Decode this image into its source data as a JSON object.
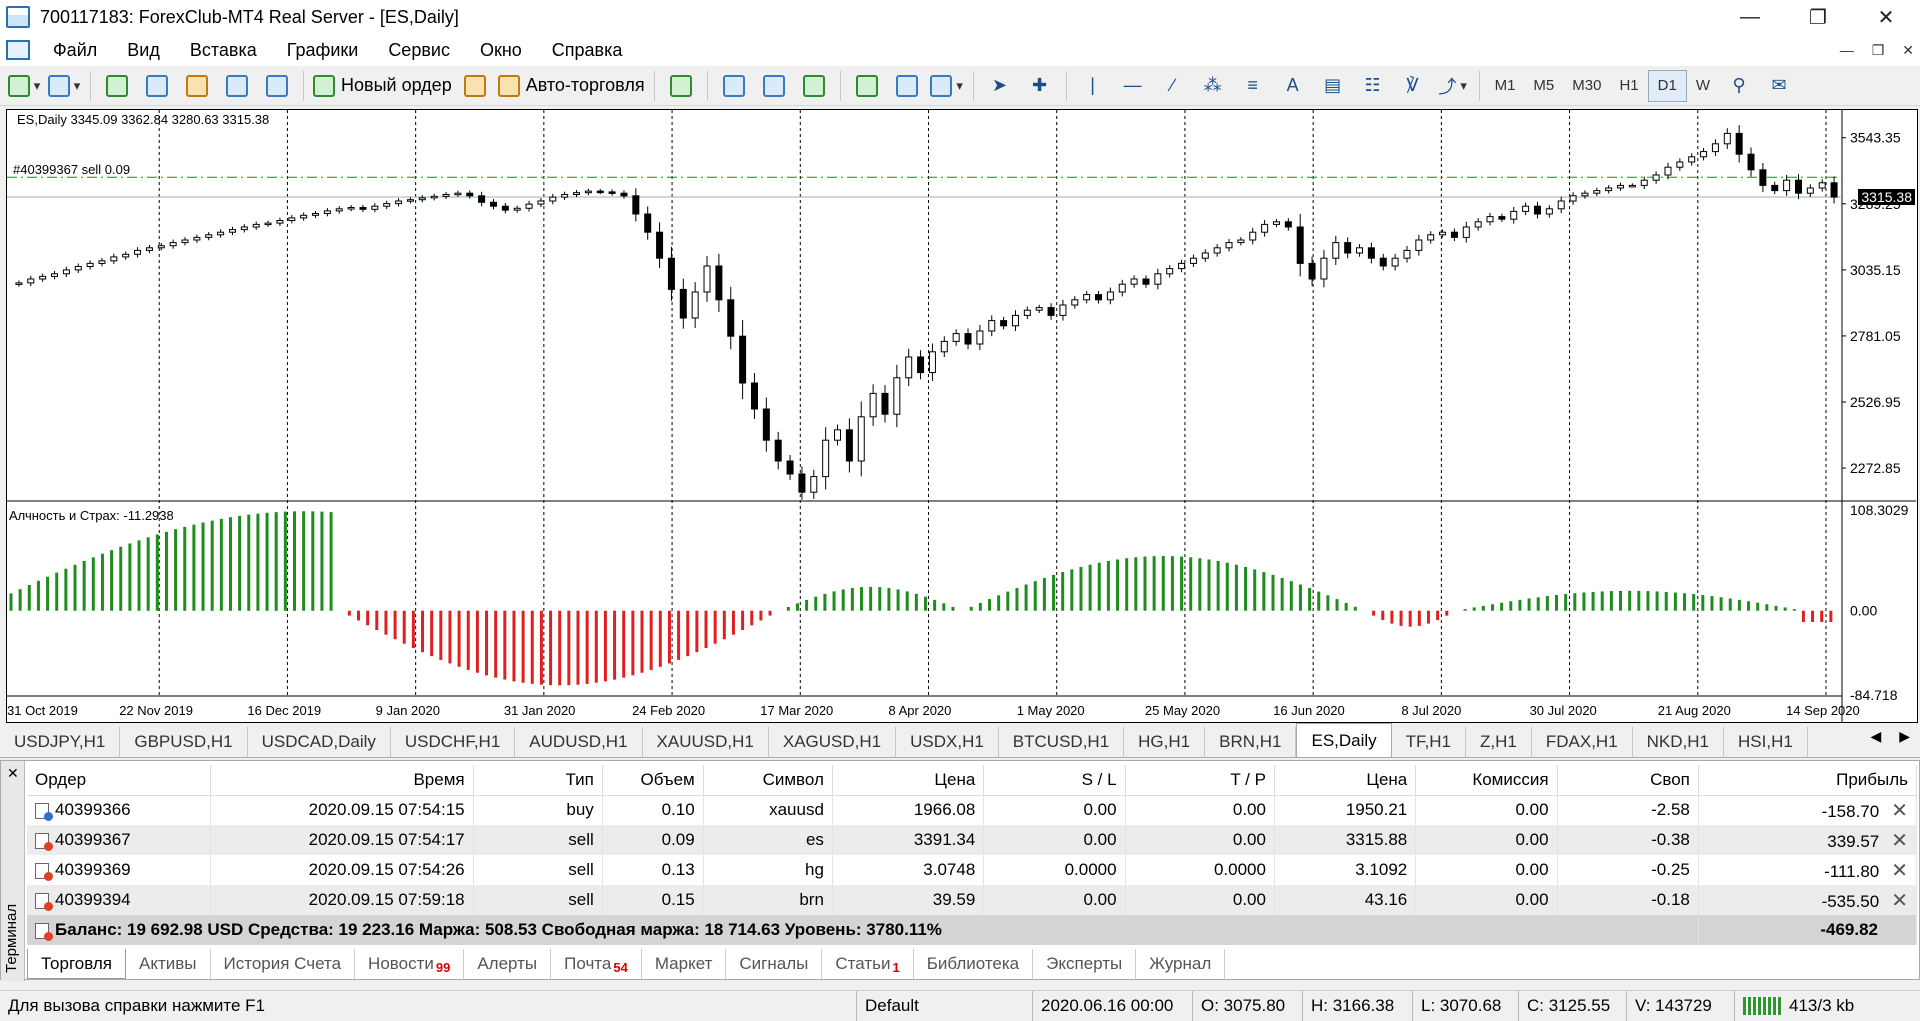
{
  "window": {
    "title": "700117183: ForexClub-MT4 Real Server - [ES,Daily]"
  },
  "menu": [
    "Файл",
    "Вид",
    "Вставка",
    "Графики",
    "Сервис",
    "Окно",
    "Справка"
  ],
  "toolbar": {
    "new_order": "Новый ордер",
    "autotrading": "Авто-торговля",
    "timeframes": [
      "M1",
      "M5",
      "M30",
      "H1",
      "D1",
      "W"
    ],
    "active_timeframe": "D1",
    "text_tool": "A"
  },
  "chart": {
    "header": "ES,Daily  3345.09 3362.84 3280.63 3315.38",
    "order_line_label": "#40399367 sell 0.09",
    "current_price": "3315.38",
    "price_ticks": [
      "3543.35",
      "3289.25",
      "3035.15",
      "2781.05",
      "2526.95",
      "2272.85"
    ],
    "indicator_label": "Алчность и Страх: -11.2938",
    "indicator_ticks": [
      "108.3029",
      "0.00",
      "-84.718"
    ],
    "date_ticks": [
      "31 Oct 2019",
      "22 Nov 2019",
      "16 Dec 2019",
      "9 Jan 2020",
      "31 Jan 2020",
      "24 Feb 2020",
      "17 Mar 2020",
      "8 Apr 2020",
      "1 May 2020",
      "25 May 2020",
      "16 Jun 2020",
      "8 Jul 2020",
      "30 Jul 2020",
      "21 Aug 2020",
      "14 Sep 2020"
    ],
    "colors": {
      "bull_hist": "#1e8c1e",
      "bear_hist": "#e02020",
      "order_line": "#1e8c1e",
      "candle": "#000000"
    }
  },
  "chart_data": {
    "type": "candlestick",
    "title": "ES,Daily",
    "ylim": [
      2150,
      3650
    ],
    "closes": [
      2985,
      3000,
      3010,
      3020,
      3035,
      3048,
      3060,
      3070,
      3085,
      3095,
      3110,
      3120,
      3128,
      3140,
      3150,
      3160,
      3170,
      3180,
      3190,
      3200,
      3210,
      3215,
      3225,
      3235,
      3245,
      3252,
      3262,
      3270,
      3275,
      3268,
      3280,
      3290,
      3300,
      3305,
      3312,
      3318,
      3325,
      3330,
      3320,
      3295,
      3280,
      3265,
      3272,
      3288,
      3300,
      3315,
      3325,
      3332,
      3338,
      3335,
      3330,
      3320,
      3250,
      3180,
      3080,
      2960,
      2850,
      2950,
      3050,
      2920,
      2780,
      2600,
      2500,
      2380,
      2300,
      2250,
      2180,
      2240,
      2380,
      2420,
      2300,
      2470,
      2560,
      2480,
      2620,
      2700,
      2640,
      2720,
      2760,
      2790,
      2750,
      2800,
      2840,
      2820,
      2860,
      2880,
      2890,
      2860,
      2900,
      2920,
      2940,
      2920,
      2950,
      2980,
      3000,
      2980,
      3020,
      3040,
      3060,
      3080,
      3100,
      3120,
      3140,
      3150,
      3180,
      3210,
      3220,
      3200,
      3060,
      3000,
      3080,
      3140,
      3100,
      3120,
      3080,
      3050,
      3080,
      3110,
      3150,
      3170,
      3180,
      3160,
      3200,
      3220,
      3240,
      3230,
      3260,
      3280,
      3250,
      3270,
      3300,
      3320,
      3330,
      3340,
      3350,
      3360,
      3360,
      3380,
      3400,
      3430,
      3450,
      3470,
      3490,
      3520,
      3560,
      3480,
      3420,
      3360,
      3340,
      3380,
      3330,
      3350,
      3370,
      3315
    ],
    "indicator": {
      "name": "Алчность и Страх",
      "last_value": -11.2938,
      "ylim": [
        -84.718,
        108.3029
      ]
    }
  },
  "chart_tabs": [
    "USDJPY,H1",
    "GBPUSD,H1",
    "USDCAD,Daily",
    "USDCHF,H1",
    "AUDUSD,H1",
    "XAUUSD,H1",
    "XAGUSD,H1",
    "USDX,H1",
    "BTCUSD,H1",
    "HG,H1",
    "BRN,H1",
    "ES,Daily",
    "TF,H1",
    "Z,H1",
    "FDAX,H1",
    "NKD,H1",
    "HSI,H1"
  ],
  "active_chart_tab": "ES,Daily",
  "terminal": {
    "side_label": "Терминал",
    "columns": [
      "Ордер",
      "Время",
      "Тип",
      "Объем",
      "Символ",
      "Цена",
      "S / L",
      "T / P",
      "Цена",
      "Комиссия",
      "Своп",
      "Прибыль"
    ],
    "rows": [
      [
        "40399366",
        "2020.09.15 07:54:15",
        "buy",
        "0.10",
        "xauusd",
        "1966.08",
        "0.00",
        "0.00",
        "1950.21",
        "0.00",
        "-2.58",
        "-158.70"
      ],
      [
        "40399367",
        "2020.09.15 07:54:17",
        "sell",
        "0.09",
        "es",
        "3391.34",
        "0.00",
        "0.00",
        "3315.88",
        "0.00",
        "-0.38",
        "339.57"
      ],
      [
        "40399369",
        "2020.09.15 07:54:26",
        "sell",
        "0.13",
        "hg",
        "3.0748",
        "0.0000",
        "0.0000",
        "3.1092",
        "0.00",
        "-0.25",
        "-111.80"
      ],
      [
        "40399394",
        "2020.09.15 07:59:18",
        "sell",
        "0.15",
        "brn",
        "39.59",
        "0.00",
        "0.00",
        "43.16",
        "0.00",
        "-0.18",
        "-535.50"
      ]
    ],
    "summary": "Баланс: 19 692.98 USD  Средства: 19 223.16  Маржа: 508.53  Свободная маржа: 18 714.63  Уровень: 3780.11%",
    "total_profit": "-469.82",
    "tabs": [
      {
        "label": "Торговля",
        "badge": ""
      },
      {
        "label": "Активы",
        "badge": ""
      },
      {
        "label": "История Счета",
        "badge": ""
      },
      {
        "label": "Новости",
        "badge": "99"
      },
      {
        "label": "Алерты",
        "badge": ""
      },
      {
        "label": "Почта",
        "badge": "54"
      },
      {
        "label": "Маркет",
        "badge": ""
      },
      {
        "label": "Сигналы",
        "badge": ""
      },
      {
        "label": "Статьи",
        "badge": "1"
      },
      {
        "label": "Библиотека",
        "badge": ""
      },
      {
        "label": "Эксперты",
        "badge": ""
      },
      {
        "label": "Журнал",
        "badge": ""
      }
    ],
    "active_tab": "Торговля"
  },
  "status": {
    "help": "Для вызова справки нажмите F1",
    "profile": "Default",
    "datetime": "2020.06.16 00:00",
    "open": "O: 3075.80",
    "high": "H: 3166.38",
    "low": "L: 3070.68",
    "close": "C: 3125.55",
    "volume": "V: 143729",
    "traffic": "413/3 kb"
  }
}
